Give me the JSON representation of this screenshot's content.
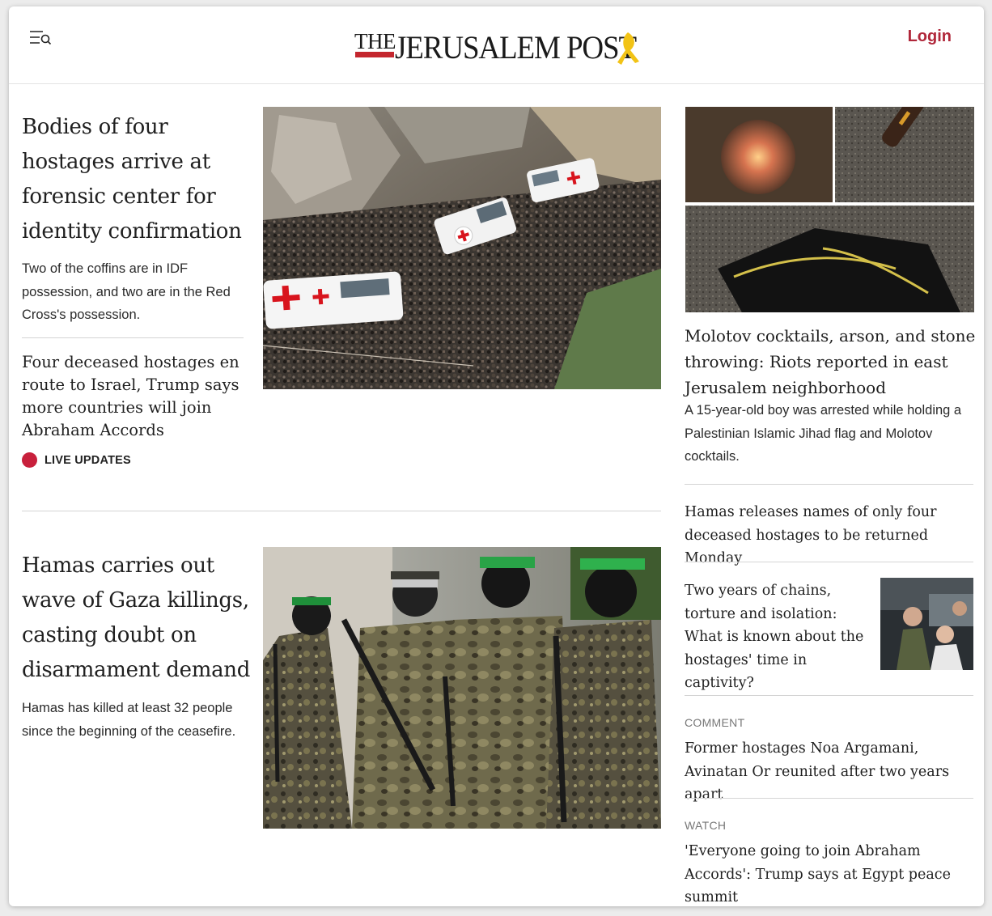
{
  "header": {
    "logo_the": "THE",
    "logo_name": "JERUSALEM POST",
    "login_label": "Login"
  },
  "lead_story": {
    "headline": "Bodies of four hostages arrive at forensic center for identity confirmation",
    "summary": "Two of the coffins are in IDF possession, and two are in the Red Cross's possession."
  },
  "second_story": {
    "headline": "Four deceased hostages en route to Israel, Trump says more countries will join Abraham Accords",
    "live_label": "LIVE UPDATES"
  },
  "third_story": {
    "headline": "Hamas carries out wave of Gaza killings, casting doubt on disarmament demand",
    "summary": "Hamas has killed at least 32 people since the beginning of the ceasefire."
  },
  "rail": {
    "top_story": {
      "headline": "Molotov cocktails, arson, and stone throwing: Riots reported in east Jerusalem neighborhood",
      "summary": "A 15-year-old boy was arrested while holding a Palestinian Islamic Jihad flag and Molotov cocktails."
    },
    "item_1": {
      "headline": "Hamas releases names of only four deceased hostages to be returned Monday"
    },
    "item_2": {
      "headline": "Two years of chains, torture and isolation: What is known about the hostages' time in captivity?"
    },
    "item_3": {
      "kicker": "COMMENT",
      "headline": "Former hostages Noa Argamani, Avinatan Or reunited after two years apart"
    },
    "item_4": {
      "kicker": "WATCH",
      "headline": "'Everyone going to join Abraham Accords': Trump says at Egypt peace summit"
    }
  },
  "colors": {
    "brand_red": "#b0273a",
    "live_red": "#c8203c",
    "logo_red": "#c4262e",
    "ribbon_yellow": "#f2c316"
  },
  "icons": {
    "menu": "menu-search-icon",
    "live": "live-dot-icon"
  }
}
